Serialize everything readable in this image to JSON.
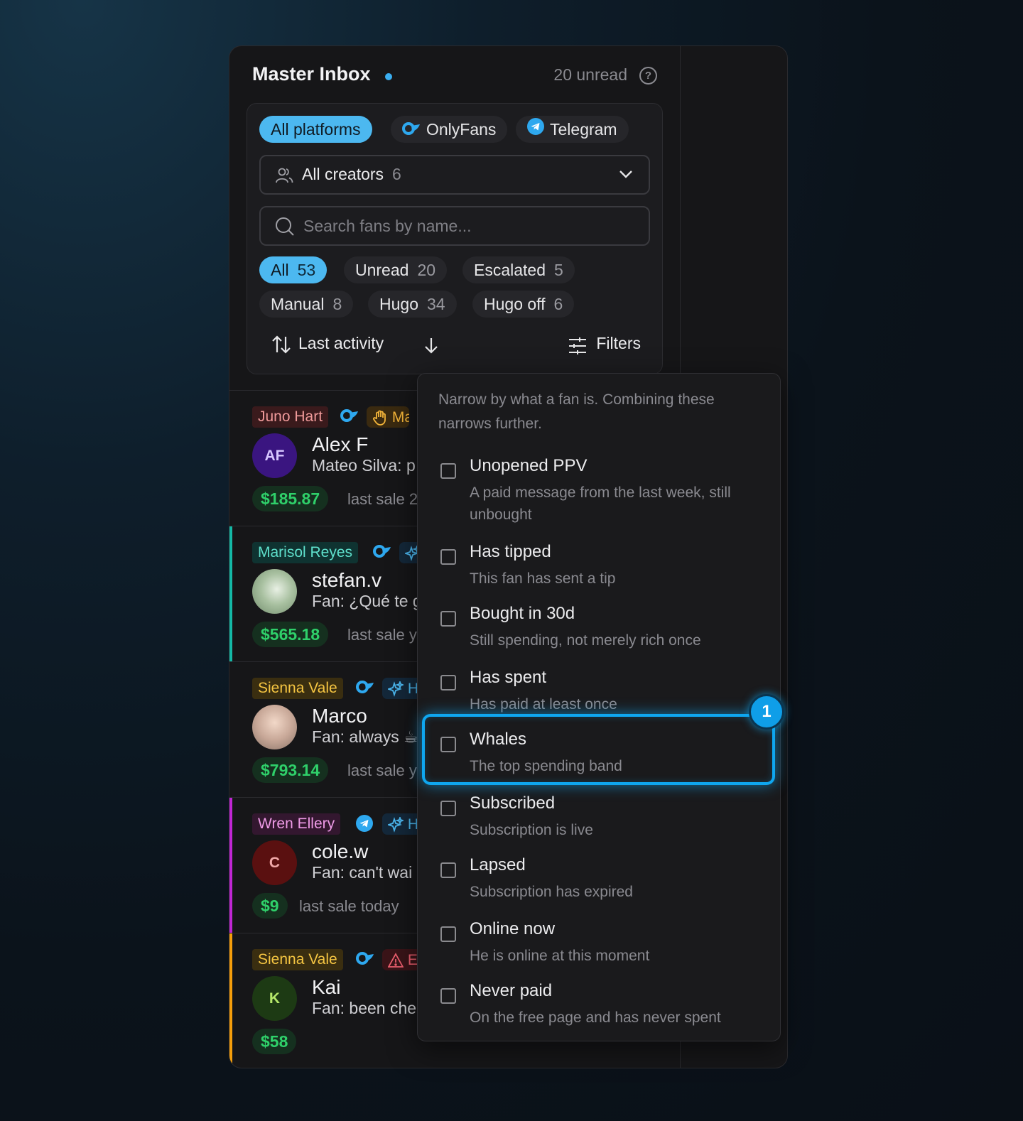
{
  "header": {
    "title": "Master Inbox",
    "unread": "20 unread",
    "help": "?"
  },
  "platforms": [
    {
      "label": "All platforms",
      "active": true
    },
    {
      "label": "OnlyFans",
      "icon": "onlyfans-icon"
    },
    {
      "label": "Telegram",
      "icon": "telegram-icon"
    }
  ],
  "creators_select": {
    "label": "All creators",
    "count": "6"
  },
  "search": {
    "placeholder": "Search fans by name..."
  },
  "status_filters": [
    {
      "label": "All",
      "count": "53",
      "active": true
    },
    {
      "label": "Unread",
      "count": "20"
    },
    {
      "label": "Escalated",
      "count": "5"
    },
    {
      "label": "Manual",
      "count": "8"
    },
    {
      "label": "Hugo",
      "count": "34"
    },
    {
      "label": "Hugo off",
      "count": "6"
    }
  ],
  "sort": {
    "label": "Last activity",
    "filters_label": "Filters"
  },
  "conversations": [
    {
      "creator": "Juno Hart",
      "platform": "onlyfans",
      "extra_tag": "Ma",
      "extra_icon": "hand-icon",
      "initials": "AF",
      "name": "Alex F",
      "preview": "Mateo Silva: p",
      "amount": "$185.87",
      "last_sale": "last sale 2"
    },
    {
      "creator": "Marisol Reyes",
      "platform": "onlyfans",
      "extra_tag": "",
      "extra_icon": "sparkle-icon",
      "initials": "",
      "name": "stefan.v",
      "preview": "Fan: ¿Qué te g",
      "amount": "$565.18",
      "last_sale": "last sale y"
    },
    {
      "creator": "Sienna Vale",
      "platform": "onlyfans",
      "extra_tag": "H",
      "extra_icon": "sparkle-icon",
      "initials": "",
      "name": "Marco",
      "preview": "Fan: always ☕",
      "amount": "$793.14",
      "last_sale": "last sale y"
    },
    {
      "creator": "Wren Ellery",
      "platform": "telegram",
      "extra_tag": "H",
      "extra_icon": "sparkle-icon",
      "initials": "C",
      "name": "cole.w",
      "preview": "Fan: can't wai",
      "amount": "$9",
      "last_sale": "last sale today"
    },
    {
      "creator": "Sienna Vale",
      "platform": "onlyfans",
      "extra_tag": "E",
      "extra_icon": "warning-icon",
      "initials": "K",
      "name": "Kai",
      "preview": "Fan: been che",
      "amount": "$58",
      "last_sale": ""
    }
  ],
  "filter_panel": {
    "intro": "Narrow by what a fan is. Combining these narrows further.",
    "options": [
      {
        "title": "Unopened PPV",
        "desc": "A paid message from the last week, still unbought"
      },
      {
        "title": "Has tipped",
        "desc": "This fan has sent a tip"
      },
      {
        "title": "Bought in 30d",
        "desc": "Still spending, not merely rich once"
      },
      {
        "title": "Has spent",
        "desc": "Has paid at least once"
      },
      {
        "title": "Whales",
        "desc": "The top spending band"
      },
      {
        "title": "Subscribed",
        "desc": "Subscription is live"
      },
      {
        "title": "Lapsed",
        "desc": "Subscription has expired"
      },
      {
        "title": "Online now",
        "desc": "He is online at this moment"
      },
      {
        "title": "Never paid",
        "desc": "On the free page and has never spent"
      }
    ]
  },
  "highlight": {
    "badge": "1"
  },
  "colors": {
    "accent": "#4cb8f0",
    "money": "#2fd06a",
    "highlight": "#0fa6ef",
    "bar_marisol": "#14b8a6",
    "bar_wren": "#c026d3",
    "bar_sienna": "#f59e0b"
  }
}
